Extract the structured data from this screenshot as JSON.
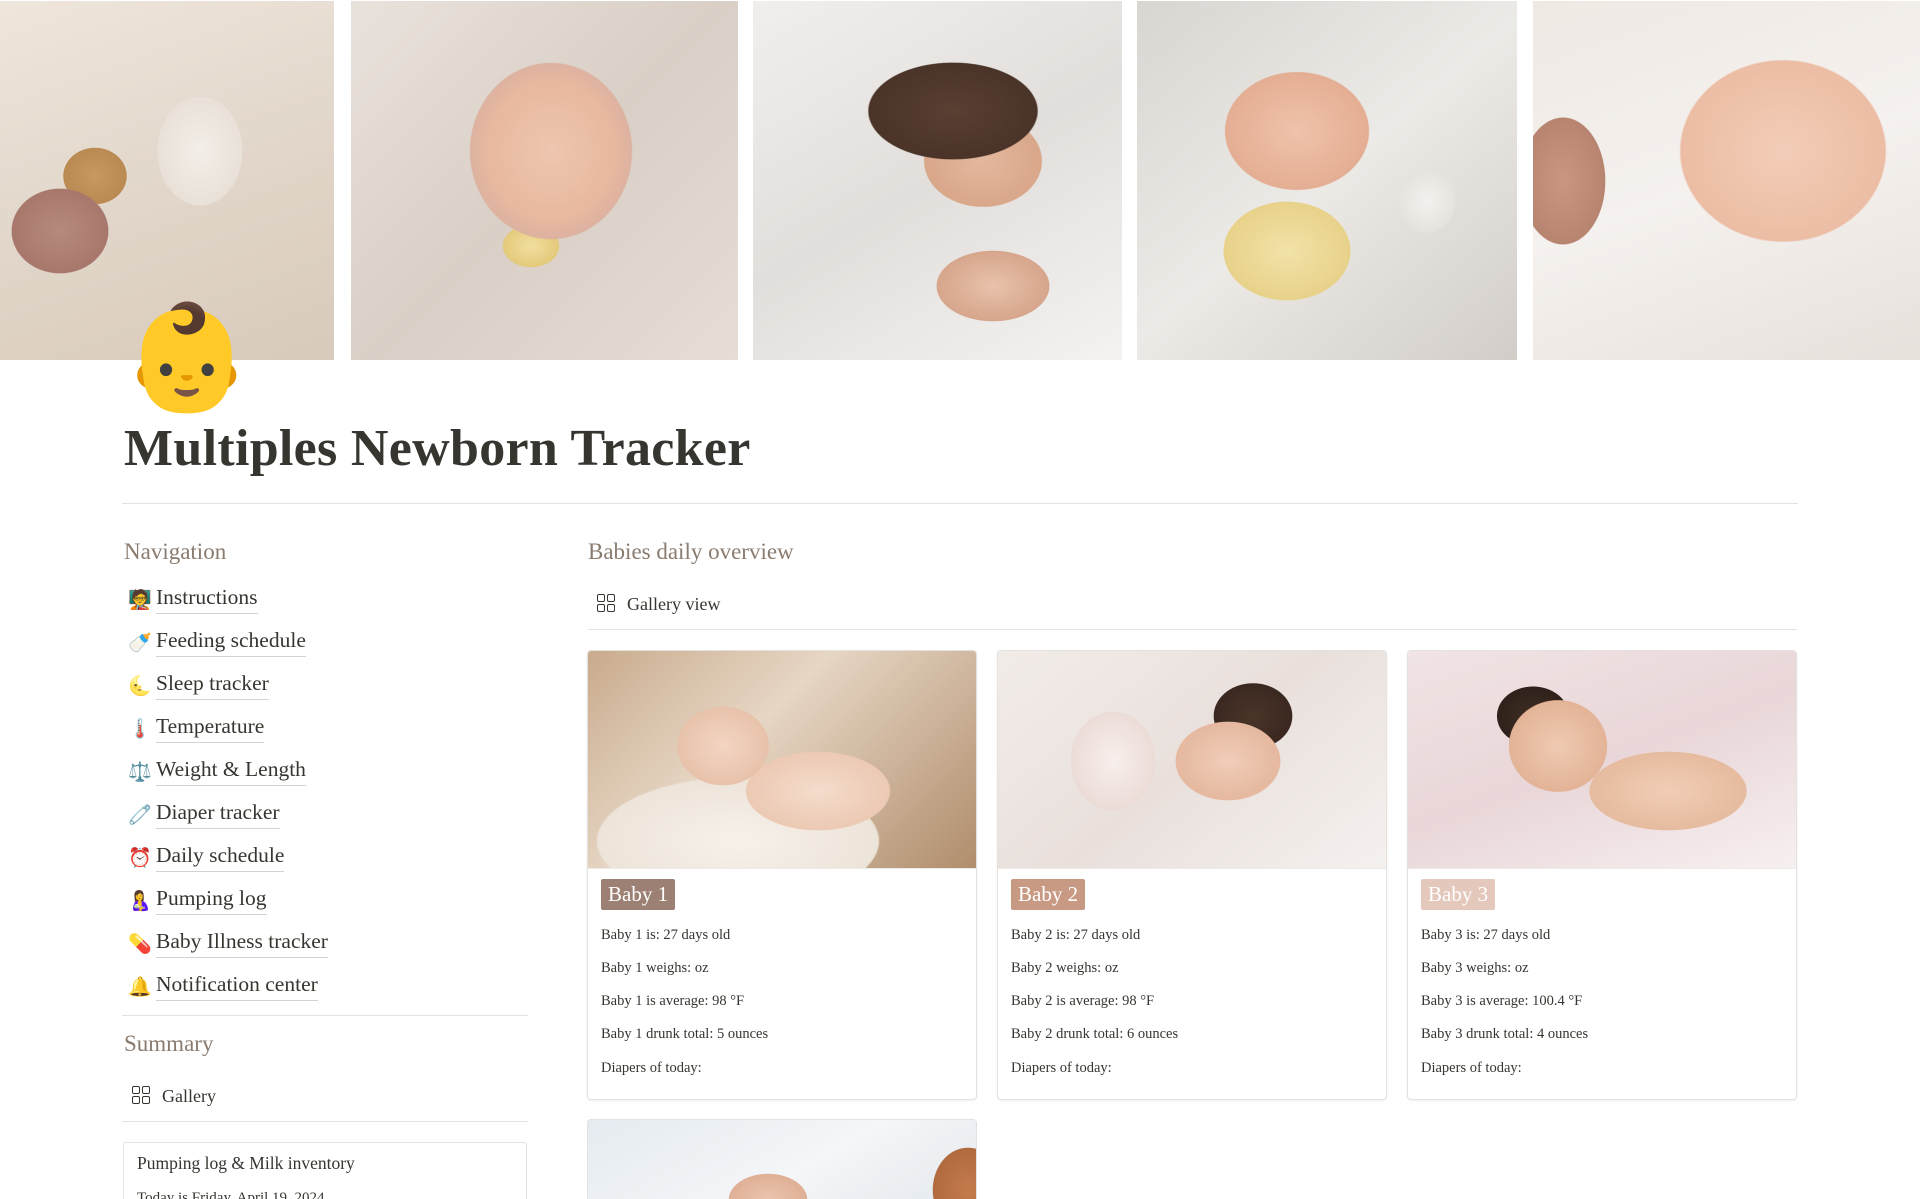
{
  "page": {
    "icon": "👶",
    "title": "Multiples Newborn Tracker"
  },
  "cover": {
    "photos": [
      "teddy-and-toy-blocks-photo",
      "baby-with-pacifier-photo",
      "mother-sleeping-with-baby-photo",
      "baby-bottle-feeding-photo",
      "baby-breastfeeding-photo"
    ]
  },
  "navigation": {
    "heading": "Navigation",
    "items": [
      {
        "icon": "🧑‍🏫",
        "label": "Instructions"
      },
      {
        "icon": "🍼",
        "label": "Feeding schedule"
      },
      {
        "icon": "🌜",
        "label": "Sleep tracker"
      },
      {
        "icon": "🌡️",
        "label": "Temperature"
      },
      {
        "icon": "⚖️",
        "label": "Weight & Length"
      },
      {
        "icon": "🧷",
        "label": "Diaper tracker"
      },
      {
        "icon": "⏰",
        "label": "Daily schedule"
      },
      {
        "icon": "🤱",
        "label": "Pumping log"
      },
      {
        "icon": "💊",
        "label": "Baby Illness tracker"
      },
      {
        "icon": "🔔",
        "label": "Notification center"
      }
    ]
  },
  "summary": {
    "heading": "Summary",
    "view_label": "Gallery",
    "card": {
      "title": "Pumping log & Milk inventory",
      "subtitle": "Today is Friday, April 19, 2024"
    }
  },
  "overview": {
    "heading": "Babies daily overview",
    "view_label": "Gallery view",
    "cards": [
      {
        "tag": "Baby 1",
        "tag_color": "#9b8073",
        "lines": [
          "Baby 1 is: 27 days old",
          "Baby 1 weighs: oz",
          "Baby 1 is average: 98 °F",
          "Baby 1 drunk total: 5 ounces",
          "Diapers of today:"
        ]
      },
      {
        "tag": "Baby 2",
        "tag_color": "#c89a83",
        "lines": [
          "Baby 2 is: 27 days old",
          "Baby 2 weighs: oz",
          "Baby 2 is average: 98 °F",
          "Baby 2 drunk total: 6 ounces",
          "Diapers of today:"
        ]
      },
      {
        "tag": "Baby 3",
        "tag_color": "#e3c8bb",
        "lines": [
          "Baby 3 is: 27 days old",
          "Baby 3 weighs: oz",
          "Baby 3 is average: 100.4 °F",
          "Baby 3 drunk total: 4 ounces",
          "Diapers of today:"
        ]
      }
    ]
  },
  "colors": {
    "text": "#37352f",
    "heading_muted": "#8a7b6f",
    "divider": "#e3e2df"
  }
}
